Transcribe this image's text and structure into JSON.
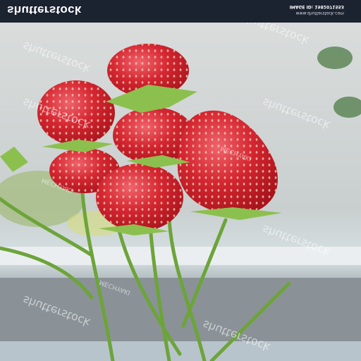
{
  "header": {
    "brand": "shutterstock",
    "image_id_line": "IMAGE ID: 1982071553",
    "site_line": "www.shutterstock.com"
  },
  "watermark": {
    "text": "shutterstock",
    "contributor": "MECHYAKI"
  },
  "colors": {
    "header_bg": "#1b2230",
    "strawberry": "#d42630",
    "stem": "#6da43a",
    "background": "#cfd4d4"
  }
}
